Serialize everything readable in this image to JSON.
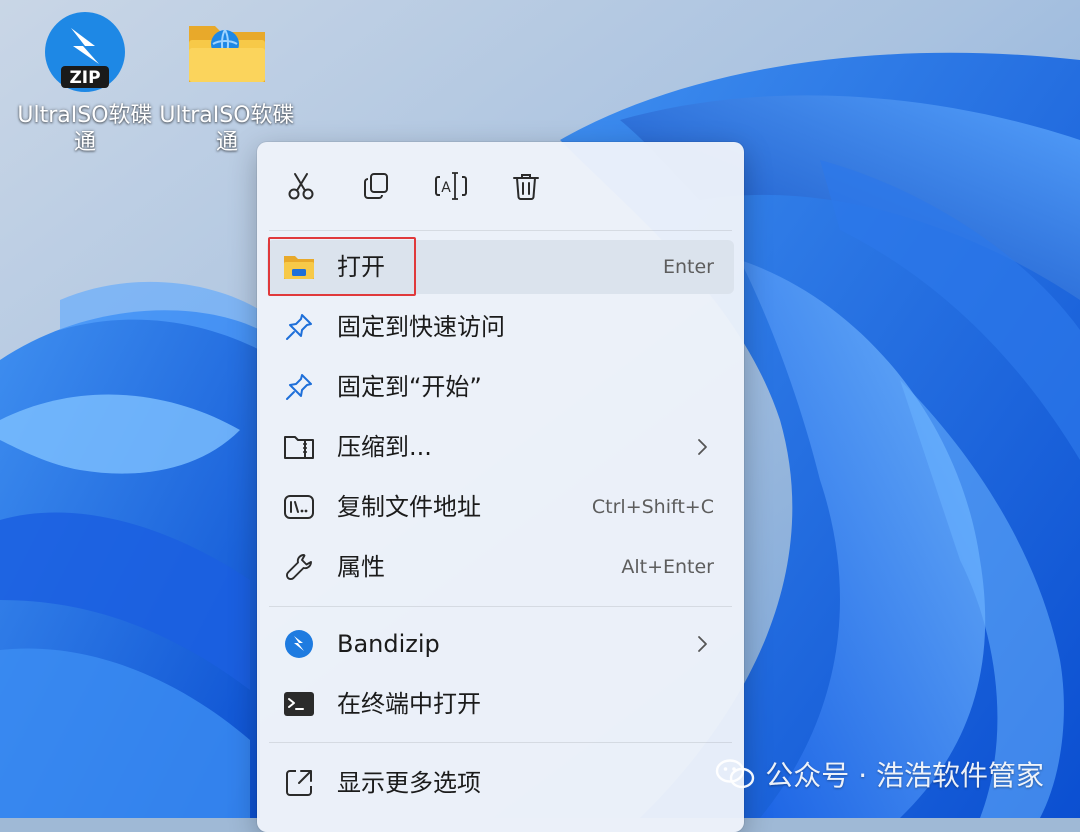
{
  "desktop": {
    "icons": [
      {
        "label": "UltraISO软碟通",
        "icon": "zip-app-icon"
      },
      {
        "label": "UltraISO软碟通",
        "icon": "folder-globe-icon"
      }
    ],
    "zip_badge": "ZIP"
  },
  "context_menu": {
    "toolbar": [
      {
        "action": "cut",
        "icon": "scissors-icon"
      },
      {
        "action": "copy",
        "icon": "copy-icon"
      },
      {
        "action": "rename",
        "icon": "rename-icon"
      },
      {
        "action": "delete",
        "icon": "trash-icon"
      }
    ],
    "items": [
      {
        "label": "打开",
        "accelerator": "Enter",
        "icon": "folder-icon",
        "highlighted": true
      },
      {
        "label": "固定到快速访问",
        "accelerator": "",
        "icon": "pin-icon"
      },
      {
        "label": "固定到“开始”",
        "accelerator": "",
        "icon": "pin-icon"
      },
      {
        "label": "压缩到...",
        "accelerator": "",
        "icon": "archive-folder-icon",
        "submenu": true
      },
      {
        "label": "复制文件地址",
        "accelerator": "Ctrl+Shift+C",
        "icon": "path-icon"
      },
      {
        "label": "属性",
        "accelerator": "Alt+Enter",
        "icon": "wrench-icon"
      },
      {
        "label": "Bandizip",
        "accelerator": "",
        "icon": "bandizip-icon",
        "submenu": true
      },
      {
        "label": "在终端中打开",
        "accelerator": "",
        "icon": "terminal-icon"
      },
      {
        "label": "显示更多选项",
        "accelerator": "",
        "icon": "more-options-icon"
      }
    ]
  },
  "watermark": {
    "text": "公众号 · 浩浩软件管家"
  },
  "colors": {
    "accent": "#0067c0",
    "highlight_border": "#e0393b",
    "folder_yellow": "#f5c542"
  }
}
